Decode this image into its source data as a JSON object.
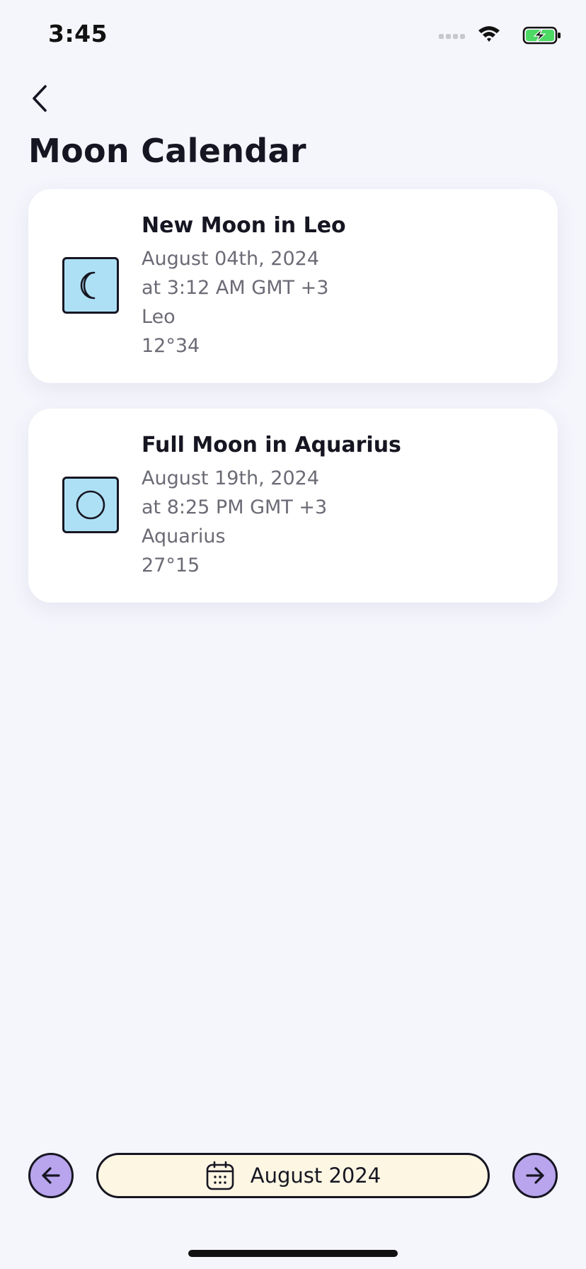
{
  "status_bar": {
    "time": "3:45",
    "icons": [
      "signal-icon",
      "wifi-icon",
      "battery-charging-icon"
    ]
  },
  "header": {
    "back_icon": "chevron-left-icon",
    "title": "Moon Calendar"
  },
  "events": [
    {
      "icon": "crescent-moon-icon",
      "title": "New Moon in Leo",
      "date": "August 04th, 2024",
      "time": "at 3:12 AM GMT +3",
      "sign": "Leo",
      "degree": "12°34"
    },
    {
      "icon": "full-moon-icon",
      "title": "Full Moon in Aquarius",
      "date": "August 19th, 2024",
      "time": "at 8:25 PM GMT +3",
      "sign": "Aquarius",
      "degree": "27°15"
    }
  ],
  "month_nav": {
    "prev_icon": "arrow-left-icon",
    "next_icon": "arrow-right-icon",
    "calendar_icon": "calendar-icon",
    "label": "August 2024"
  },
  "colors": {
    "background": "#f5f5fc",
    "card": "#ffffff",
    "phase_icon_fill": "#aee0f5",
    "nav_button_fill": "#b9a4ee",
    "month_picker_fill": "#fdf6e3",
    "battery_green": "#4cd964"
  }
}
